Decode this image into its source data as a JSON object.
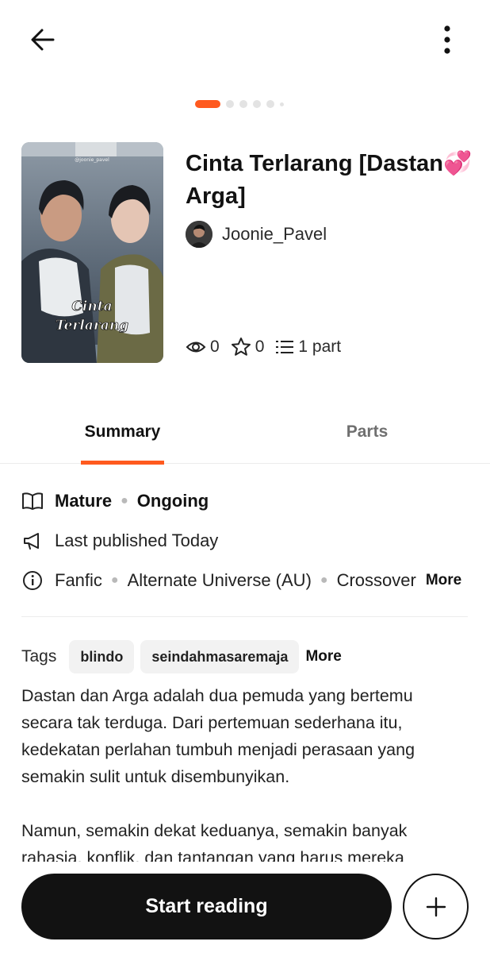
{
  "header": {
    "back_icon": "arrow-left-icon",
    "menu_icon": "kebab-menu-icon"
  },
  "carousel": {
    "total_dots": 6,
    "active_index": 0
  },
  "story": {
    "title": "Cinta Terlarang [Dastan💞 Arga]",
    "author": "Joonie_Pavel",
    "cover": {
      "watermark": "@joonie_pavel",
      "title_line1": "Cinta",
      "title_line2": "Terlarang"
    },
    "stats": {
      "reads": "0",
      "votes": "0",
      "parts": "1 part"
    }
  },
  "tabs": [
    {
      "label": "Summary",
      "active": true
    },
    {
      "label": "Parts",
      "active": false
    }
  ],
  "details": {
    "rating": "Mature",
    "status": "Ongoing",
    "published": "Last published Today",
    "categories": [
      "Fanfic",
      "Alternate Universe (AU)",
      "Crossover"
    ],
    "more_label": "More"
  },
  "tags": {
    "label": "Tags",
    "items": [
      "blindo",
      "seindahmasaremaja"
    ],
    "more_label": "More"
  },
  "description": {
    "paragraph1": "Dastan dan Arga adalah dua pemuda yang bertemu secara tak terduga. Dari pertemuan sederhana itu, kedekatan perlahan tumbuh menjadi perasaan yang semakin sulit untuk disembunyikan.",
    "paragraph2": "Namun, semakin dekat keduanya, semakin banyak rahasia, konflik, dan tantangan yang harus mereka"
  },
  "actions": {
    "start_reading": "Start reading",
    "add_icon": "plus-icon"
  },
  "colors": {
    "accent": "#ff5a1f",
    "text": "#121212",
    "button_bg": "#121212"
  }
}
